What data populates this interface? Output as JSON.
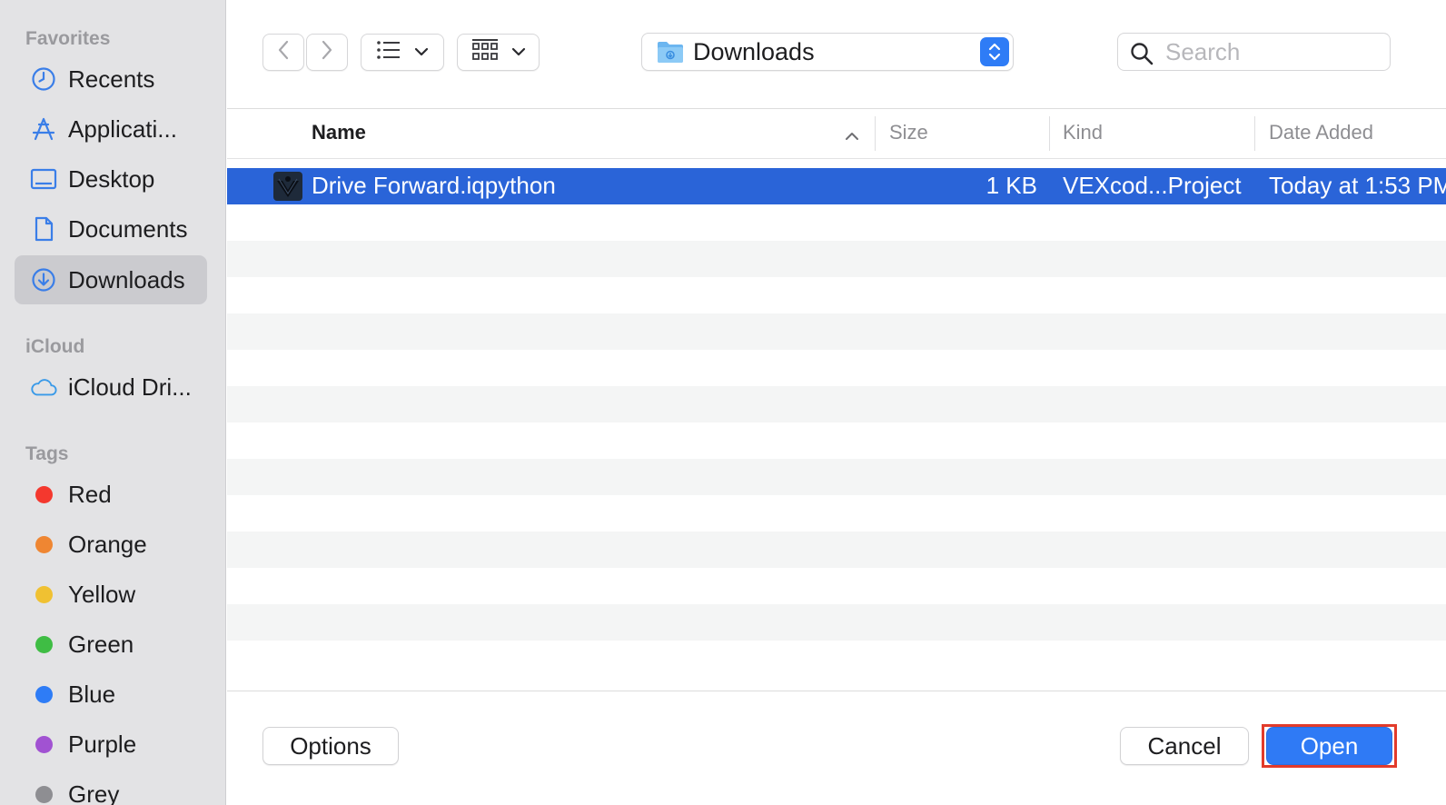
{
  "sidebar": {
    "favorites_heading": "Favorites",
    "favorites": [
      {
        "label": "Recents",
        "icon": "clock-icon"
      },
      {
        "label": "Applicati...",
        "icon": "applications-icon"
      },
      {
        "label": "Desktop",
        "icon": "desktop-icon"
      },
      {
        "label": "Documents",
        "icon": "document-icon"
      },
      {
        "label": "Downloads",
        "icon": "download-icon",
        "selected": true
      }
    ],
    "icloud_heading": "iCloud",
    "icloud": [
      {
        "label": "iCloud Dri...",
        "icon": "cloud-icon"
      }
    ],
    "tags_heading": "Tags",
    "tags": [
      {
        "label": "Red",
        "color": "#f4382e"
      },
      {
        "label": "Orange",
        "color": "#ef8632"
      },
      {
        "label": "Yellow",
        "color": "#f0c132"
      },
      {
        "label": "Green",
        "color": "#3fbd44"
      },
      {
        "label": "Blue",
        "color": "#2e7cf6"
      },
      {
        "label": "Purple",
        "color": "#a152d2"
      },
      {
        "label": "Grey",
        "color": "#8e8e92"
      }
    ]
  },
  "toolbar": {
    "location": "Downloads",
    "search_placeholder": "Search"
  },
  "file_list": {
    "columns": {
      "name": "Name",
      "size": "Size",
      "kind": "Kind",
      "date_added": "Date Added"
    },
    "sort_column": "Name",
    "files": [
      {
        "name": "Drive Forward.iqpython",
        "size": "1 KB",
        "kind": "VEXcod...Project",
        "date_added": "Today at 1:53 PM",
        "selected": true
      }
    ]
  },
  "footer": {
    "options_label": "Options",
    "cancel_label": "Cancel",
    "open_label": "Open"
  },
  "colors": {
    "accent": "#2f7af5",
    "selection": "#2a64d8",
    "highlight_ring": "#e23b2b"
  }
}
